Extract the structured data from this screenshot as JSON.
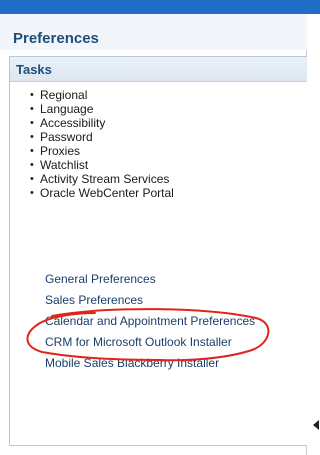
{
  "preferences": {
    "title": "Preferences"
  },
  "tasks": {
    "header": "Tasks",
    "items": [
      {
        "label": "Regional"
      },
      {
        "label": "Language"
      },
      {
        "label": "Accessibility"
      },
      {
        "label": "Password"
      },
      {
        "label": "Proxies"
      },
      {
        "label": "Watchlist"
      },
      {
        "label": "Activity Stream Services"
      },
      {
        "label": "Oracle WebCenter Portal"
      }
    ]
  },
  "links": [
    {
      "label": "General Preferences"
    },
    {
      "label": "Sales Preferences"
    },
    {
      "label": "Calendar and Appointment Preferences"
    },
    {
      "label": "CRM for Microsoft Outlook Installer"
    },
    {
      "label": "Mobile Sales Blackberry Installer"
    }
  ],
  "colors": {
    "header_blue": "#1f6dc6",
    "title_text": "#1f4e79",
    "annotation_red": "#e0241b"
  },
  "icons": {
    "bullet": "bullet-icon",
    "scroll": "scroll-left-arrow-icon"
  }
}
